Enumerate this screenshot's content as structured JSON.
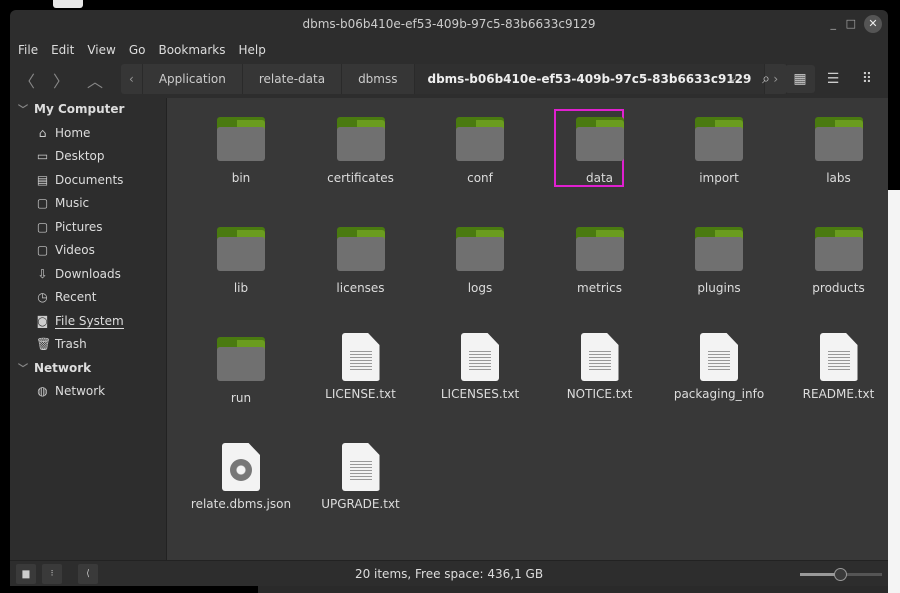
{
  "window": {
    "title": "dbms-b06b410e-ef53-409b-97c5-83b6633c9129"
  },
  "menu": [
    "File",
    "Edit",
    "View",
    "Go",
    "Bookmarks",
    "Help"
  ],
  "breadcrumb": [
    "Application",
    "relate-data",
    "dbmss",
    "dbms-b06b410e-ef53-409b-97c5-83b6633c9129"
  ],
  "sidebar": {
    "sections": [
      {
        "title": "My Computer",
        "items": [
          {
            "label": "Home",
            "icon": "home-icon"
          },
          {
            "label": "Desktop",
            "icon": "desktop-icon"
          },
          {
            "label": "Documents",
            "icon": "documents-icon"
          },
          {
            "label": "Music",
            "icon": "folder-icon"
          },
          {
            "label": "Pictures",
            "icon": "folder-icon"
          },
          {
            "label": "Videos",
            "icon": "folder-icon"
          },
          {
            "label": "Downloads",
            "icon": "download-icon"
          },
          {
            "label": "Recent",
            "icon": "recent-icon"
          },
          {
            "label": "File System",
            "icon": "drive-icon"
          },
          {
            "label": "Trash",
            "icon": "trash-icon"
          }
        ]
      },
      {
        "title": "Network",
        "items": [
          {
            "label": "Network",
            "icon": "globe-icon"
          }
        ]
      }
    ]
  },
  "items": [
    {
      "name": "bin",
      "type": "folder"
    },
    {
      "name": "certificates",
      "type": "folder"
    },
    {
      "name": "conf",
      "type": "folder"
    },
    {
      "name": "data",
      "type": "folder",
      "selected": true
    },
    {
      "name": "import",
      "type": "folder"
    },
    {
      "name": "labs",
      "type": "folder"
    },
    {
      "name": "lib",
      "type": "folder"
    },
    {
      "name": "licenses",
      "type": "folder"
    },
    {
      "name": "logs",
      "type": "folder"
    },
    {
      "name": "metrics",
      "type": "folder"
    },
    {
      "name": "plugins",
      "type": "folder"
    },
    {
      "name": "products",
      "type": "folder"
    },
    {
      "name": "run",
      "type": "folder"
    },
    {
      "name": "LICENSE.txt",
      "type": "text"
    },
    {
      "name": "LICENSES.txt",
      "type": "text"
    },
    {
      "name": "NOTICE.txt",
      "type": "text"
    },
    {
      "name": "packaging_info",
      "type": "text"
    },
    {
      "name": "README.txt",
      "type": "text"
    },
    {
      "name": "relate.dbms.json",
      "type": "json"
    },
    {
      "name": "UPGRADE.txt",
      "type": "text"
    }
  ],
  "status": {
    "text": "20 items, Free space: 436,1 GB",
    "zoom_level": 0.5
  },
  "colors": {
    "folder_tab": "#6a9c1f",
    "selection": "#e020d0"
  }
}
